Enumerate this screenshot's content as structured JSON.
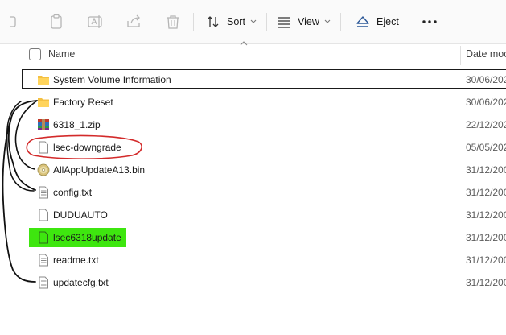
{
  "toolbar": {
    "sort_label": "Sort",
    "view_label": "View",
    "eject_label": "Eject",
    "more_label": "..."
  },
  "columns": {
    "name": "Name",
    "date_modified": "Date moc"
  },
  "files": [
    {
      "name": "System Volume Information",
      "date": "30/06/202",
      "icon": "folder-icon",
      "selected": true
    },
    {
      "name": "Factory Reset",
      "date": "30/06/202",
      "icon": "folder-icon"
    },
    {
      "name": "6318_1.zip",
      "date": "22/12/202",
      "icon": "archive-icon"
    },
    {
      "name": "lsec-downgrade",
      "date": "05/05/202",
      "icon": "file-icon",
      "annotation": "red-circle"
    },
    {
      "name": "AllAppUpdateA13.bin",
      "date": "31/12/200",
      "icon": "disc-icon"
    },
    {
      "name": "config.txt",
      "date": "31/12/200",
      "icon": "text-file-icon"
    },
    {
      "name": "DUDUAUTO",
      "date": "31/12/200",
      "icon": "file-icon"
    },
    {
      "name": "lsec6318update",
      "date": "31/12/200",
      "icon": "file-icon",
      "annotation": "green-highlight"
    },
    {
      "name": "readme.txt",
      "date": "31/12/200",
      "icon": "text-file-icon"
    },
    {
      "name": "updatecfg.txt",
      "date": "31/12/200",
      "icon": "text-file-icon"
    }
  ],
  "colors": {
    "folder": "#f4c042",
    "selection_border": "#1a1a1a",
    "red_annotation": "#d32a2a",
    "green_highlight": "#3ee60f",
    "eject_icon": "#2b5797"
  }
}
